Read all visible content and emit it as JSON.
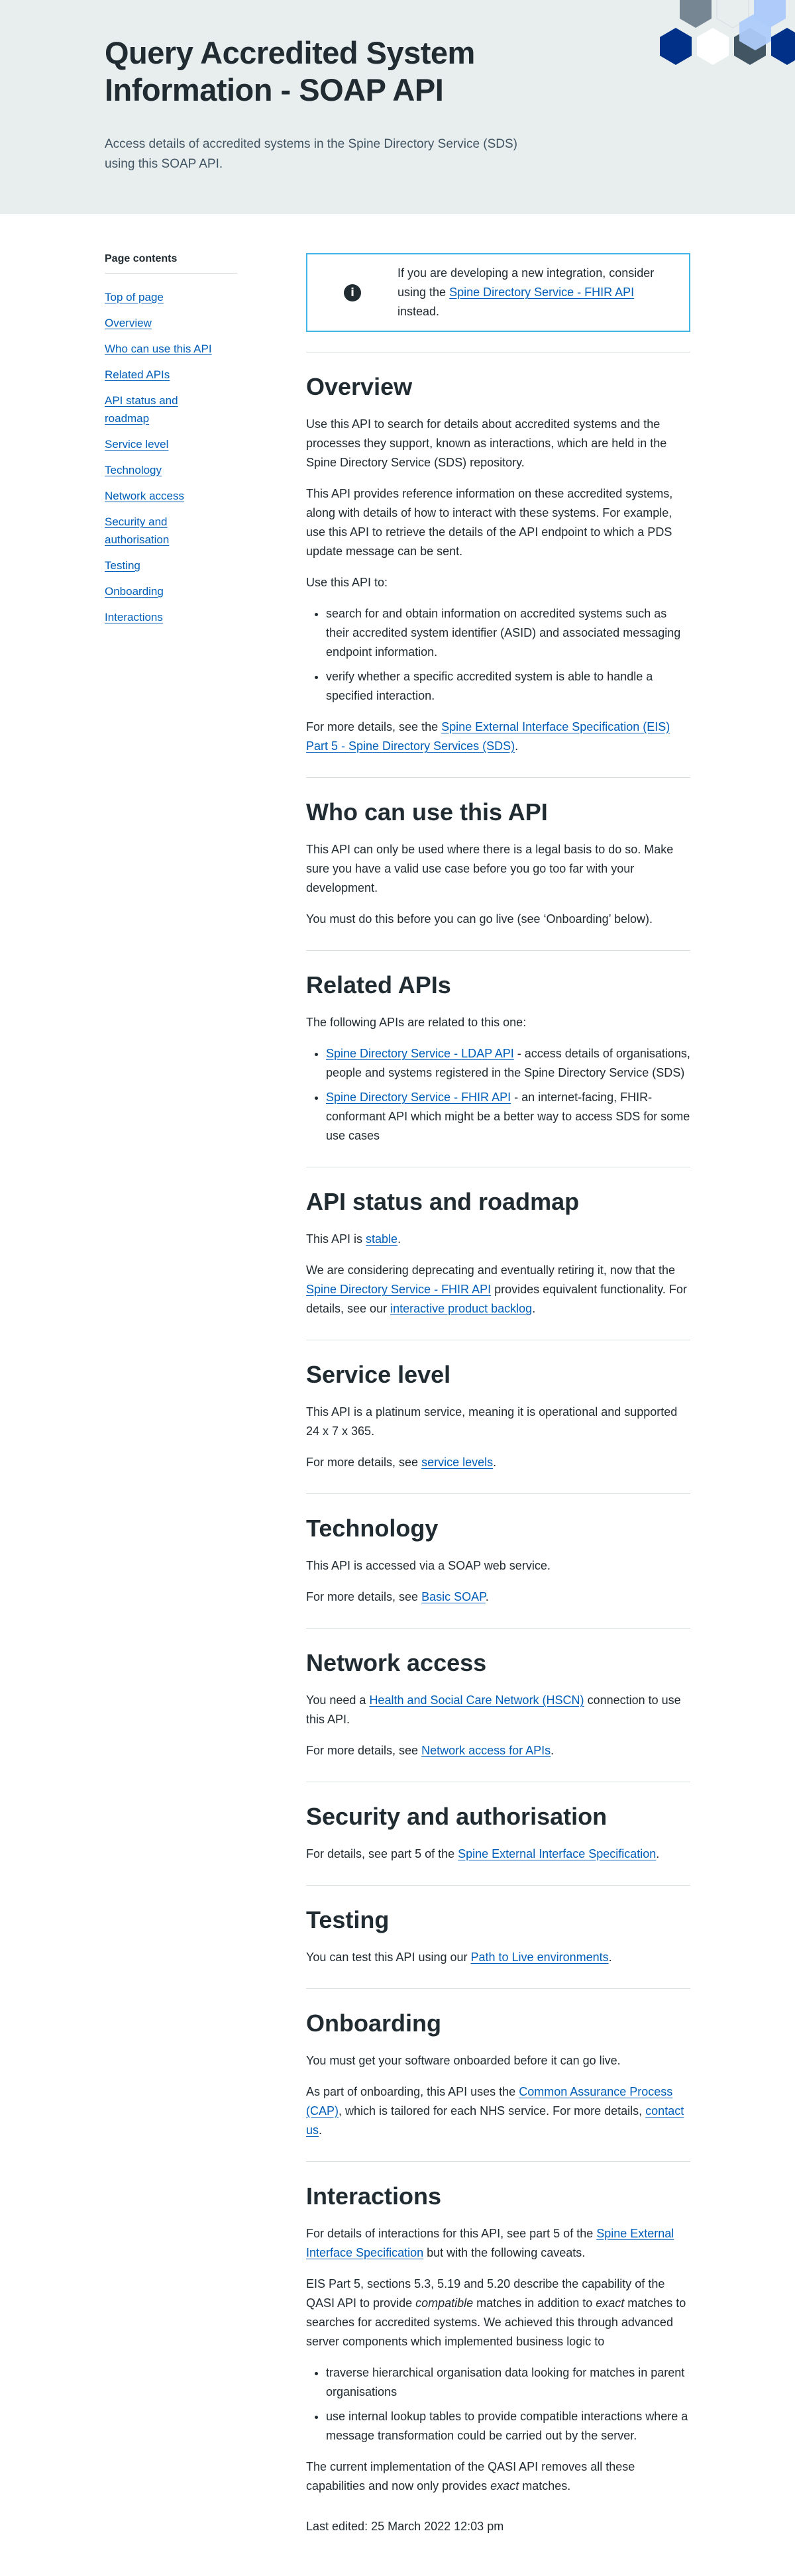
{
  "hero": {
    "title": "Query Accredited System Information - SOAP API",
    "lead": "Access details of accredited systems in the Spine Directory Service (SDS) using this SOAP API."
  },
  "colors": {
    "hero_bg": "#e8edee",
    "link": "#005eb8",
    "text": "#212b32",
    "info_border": "#41b6e6",
    "hex_dark_blue": "#003087",
    "hex_light_blue": "#aecbfa",
    "hex_grey": "#425563"
  },
  "sidebar": {
    "heading": "Page contents",
    "items": [
      {
        "label": "Top of page"
      },
      {
        "label": "Overview"
      },
      {
        "label": "Who can use this API"
      },
      {
        "label": "Related APIs"
      },
      {
        "label": "API status and roadmap"
      },
      {
        "label": "Service level"
      },
      {
        "label": "Technology"
      },
      {
        "label": "Network access"
      },
      {
        "label": "Security and authorisation"
      },
      {
        "label": "Testing"
      },
      {
        "label": "Onboarding"
      },
      {
        "label": "Interactions"
      }
    ]
  },
  "info_callout": {
    "icon": "info-icon",
    "text_before": "If you are developing a new integration, consider using the ",
    "link": "Spine Directory Service - FHIR API",
    "text_after": " instead."
  },
  "overview": {
    "title": "Overview",
    "p1": "Use this API to search for details about accredited systems and the processes they support, known as interactions, which are held in the Spine Directory Service (SDS) repository.",
    "p2": "This API provides reference information on these accredited systems, along with details of how to interact with these systems. For example, use this API to retrieve the details of the API endpoint to which a PDS update message can be sent.",
    "p3": "Use this API to:",
    "bullets": [
      "search for and obtain information on accredited systems such as their accredited system identifier (ASID) and associated messaging endpoint information.",
      "verify whether a specific accredited system is able to handle a specified interaction."
    ],
    "p4_before": "For more details, see the ",
    "p4_link": "Spine External Interface Specification (EIS) Part 5 - Spine Directory Services (SDS)",
    "p4_after": "."
  },
  "who": {
    "title": "Who can use this API",
    "p1": "This API can only be used where there is a legal basis to do so. Make sure you have a valid use case before you go too far with your development.",
    "p2": "You must do this before you can go live (see ‘Onboarding’ below)."
  },
  "related": {
    "title": "Related APIs",
    "p1": "The following APIs are related to this one:",
    "items": [
      {
        "link": "Spine Directory Service - LDAP API",
        "text": " - access details of organisations, people and systems registered in the Spine Directory Service (SDS)"
      },
      {
        "link": "Spine Directory Service - FHIR API",
        "text": " - an internet-facing, FHIR-conformant API which might be a better way to access SDS for some use cases"
      }
    ]
  },
  "status": {
    "title": "API status and roadmap",
    "p1_before": "This API is ",
    "p1_link": "stable",
    "p1_after": ".",
    "p2_before": "We are considering deprecating and eventually retiring it, now that the ",
    "p2_link1": "Spine Directory Service - FHIR API",
    "p2_mid": " provides equivalent functionality. For details, see our ",
    "p2_link2": "interactive product backlog",
    "p2_after": "."
  },
  "service_level": {
    "title": "Service level",
    "p1": "This API is a platinum service, meaning it is operational and supported 24 x 7 x 365.",
    "p2_before": "For more details, see ",
    "p2_link": "service levels",
    "p2_after": "."
  },
  "technology": {
    "title": "Technology",
    "p1": "This API is accessed via a SOAP web service.",
    "p2_before": "For more details, see ",
    "p2_link": "Basic SOAP",
    "p2_after": "."
  },
  "network": {
    "title": "Network access",
    "p1_before": "You need a ",
    "p1_link": "Health and Social Care Network (HSCN)",
    "p1_after": " connection to use this API.",
    "p2_before": "For more details, see ",
    "p2_link": "Network access for APIs",
    "p2_after": "."
  },
  "security": {
    "title": "Security and authorisation",
    "p1_before": "For details, see part 5 of the ",
    "p1_link": "Spine External Interface Specification",
    "p1_after": "."
  },
  "testing": {
    "title": "Testing",
    "p1_before": "You can test this API using our ",
    "p1_link": "Path to Live environments",
    "p1_after": "."
  },
  "onboarding": {
    "title": "Onboarding",
    "p1": "You must get your software onboarded before it can go live.",
    "p2_before": "As part of onboarding, this API uses the ",
    "p2_link1": "Common Assurance Process (CAP)",
    "p2_mid": ", which is tailored for each NHS service. For more details, ",
    "p2_link2": "contact us",
    "p2_after": "."
  },
  "interactions": {
    "title": "Interactions",
    "p1_before": "For details of interactions for this API, see part 5 of the ",
    "p1_link": "Spine External Interface Specification",
    "p1_after": " but with the following caveats.",
    "p2_a": "EIS Part 5, sections 5.3, 5.19 and 5.20 describe the capability of the QASI API to provide ",
    "p2_em1": "compatible",
    "p2_b": " matches in addition to ",
    "p2_em2": "exact",
    "p2_c": " matches to searches for accredited systems. We achieved this through advanced server components which implemented business logic to",
    "bullets": [
      "traverse hierarchical organisation data looking for matches in parent organisations",
      "use internal lookup tables to provide compatible interactions where a message transformation could be carried out by the server."
    ],
    "p3_before": "The current implementation of the QASI API removes all these capabilities and now only provides ",
    "p3_em": "exact",
    "p3_after": " matches."
  },
  "footer": {
    "last_edited": "Last edited: 25 March 2022 12:03 pm"
  }
}
